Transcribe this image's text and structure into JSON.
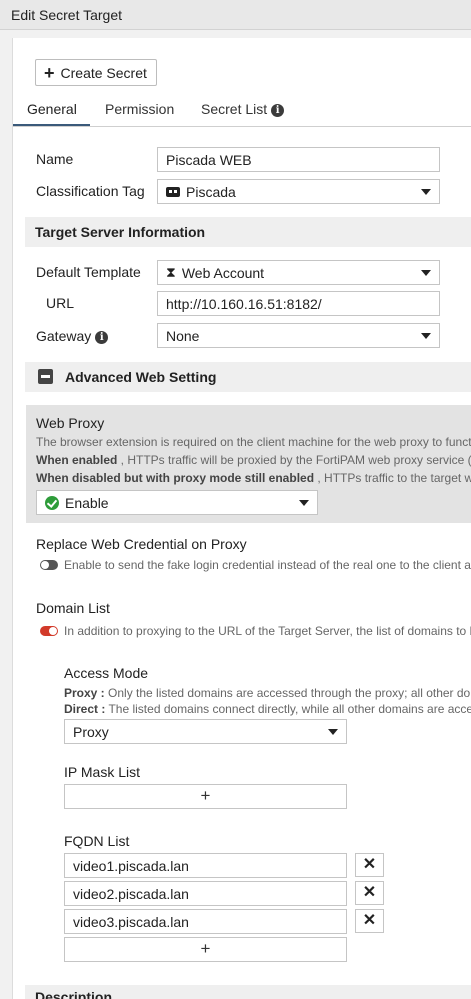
{
  "window": {
    "title": "Edit Secret Target"
  },
  "toolbar": {
    "create_label": "Create Secret"
  },
  "tabs": [
    {
      "label": "General",
      "active": true
    },
    {
      "label": "Permission"
    },
    {
      "label": "Secret List"
    }
  ],
  "general": {
    "name": {
      "label": "Name",
      "value": "Piscada WEB"
    },
    "classification": {
      "label": "Classification Tag",
      "value": "Piscada"
    }
  },
  "target_server": {
    "heading": "Target Server Information",
    "template": {
      "label": "Default Template",
      "value": "Web Account"
    },
    "url": {
      "label": "URL",
      "value": "http://10.160.16.51:8182/"
    },
    "gateway": {
      "label": "Gateway",
      "value": "None"
    }
  },
  "advanced": {
    "heading": "Advanced Web Setting",
    "web_proxy": {
      "label": "Web Proxy",
      "desc_line1": "The browser extension is required on the client machine for the web proxy to funct",
      "desc_line2_bold": "When enabled",
      "desc_line2": " , HTTPs traffic will be proxied by the FortiPAM web proxy service (c",
      "desc_line3_bold": "When disabled but with proxy mode still enabled",
      "desc_line3": " , HTTPs traffic to the target web",
      "value": "Enable"
    },
    "replace_credential": {
      "label": "Replace Web Credential on Proxy",
      "desc": "Enable to send the fake login credential instead of the real one to the client ar",
      "enabled": false
    },
    "domain_list": {
      "label": "Domain List",
      "desc": "In addition to proxying to the URL of the Target Server, the list of domains to b",
      "enabled": true
    },
    "access_mode": {
      "label": "Access Mode",
      "proxy_bold": "Proxy :",
      "proxy_desc": " Only the listed domains are accessed through the proxy; all other dom",
      "direct_bold": "Direct :",
      "direct_desc": " The listed domains connect directly, while all other domains are acces",
      "value": "Proxy"
    },
    "ip_mask_list": {
      "label": "IP Mask List",
      "add_symbol": "+"
    },
    "fqdn_list": {
      "label": "FQDN List",
      "items": [
        "video1.piscada.lan",
        "video2.piscada.lan",
        "video3.piscada.lan"
      ],
      "remove_symbol": "✕",
      "add_symbol": "+"
    }
  },
  "description": {
    "heading": "Description"
  },
  "colors": {
    "toggle_on": "#d23a2a",
    "enable_check": "#2e9c3a",
    "tab_underline": "#3a5a7a"
  },
  "icons": {
    "create": "plus-icon",
    "info": "info-icon",
    "classification": "tag-icon",
    "template": "hourglass-icon",
    "collapse": "minus-square-icon",
    "enable": "check-circle-icon",
    "remove": "close-icon",
    "add": "plus-icon"
  }
}
